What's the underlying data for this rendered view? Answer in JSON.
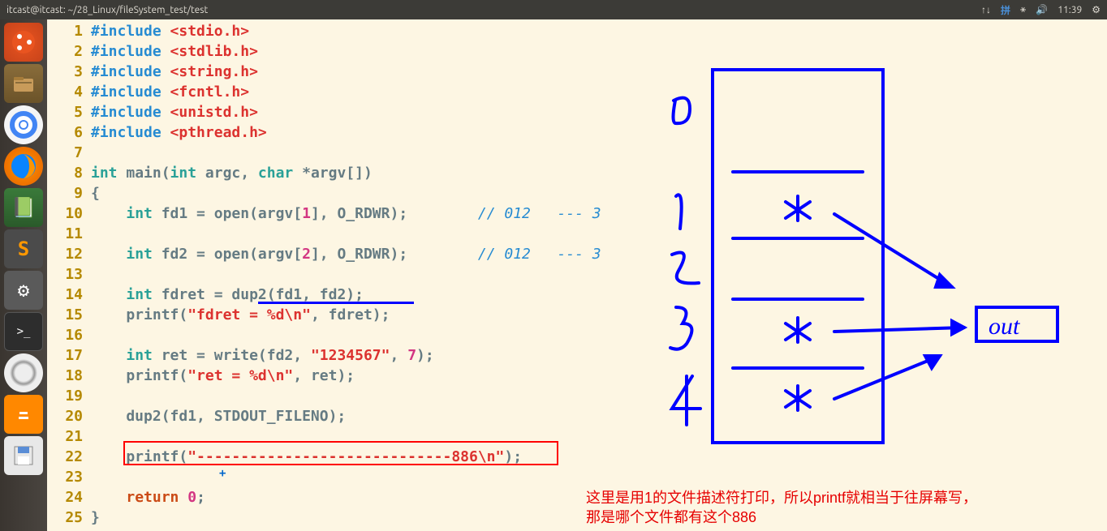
{
  "topbar": {
    "title": "itcast@itcast: ~/28_Linux/fileSystem_test/test",
    "ime": "拼",
    "time": "11:39"
  },
  "gutter_lines": [
    "1",
    "2",
    "3",
    "4",
    "5",
    "6",
    "7",
    "8",
    "9",
    "10",
    "11",
    "12",
    "13",
    "14",
    "15",
    "16",
    "17",
    "18",
    "19",
    "20",
    "21",
    "22",
    "23",
    "24",
    "25"
  ],
  "code": {
    "l1": {
      "inc": "#include ",
      "hdr": "<stdio.h>"
    },
    "l2": {
      "inc": "#include ",
      "hdr": "<stdlib.h>"
    },
    "l3": {
      "inc": "#include ",
      "hdr": "<string.h>"
    },
    "l4": {
      "inc": "#include ",
      "hdr": "<fcntl.h>"
    },
    "l5": {
      "inc": "#include ",
      "hdr": "<unistd.h>"
    },
    "l6": {
      "inc": "#include ",
      "hdr": "<pthread.h>"
    },
    "l8": {
      "a": "int",
      "b": " main(",
      "c": "int",
      "d": " argc, ",
      "e": "char",
      "f": " *argv[])"
    },
    "l9": "{",
    "l10": {
      "a": "    ",
      "b": "int",
      "c": " fd1 = open(argv[",
      "d": "1",
      "e": "], O_RDWR);        ",
      "f": "// 012   --- 3"
    },
    "l12": {
      "a": "    ",
      "b": "int",
      "c": " fd2 = open(argv[",
      "d": "2",
      "e": "], O_RDWR);        ",
      "f": "// 012   --- 3"
    },
    "l14": {
      "a": "    ",
      "b": "int",
      "c": " fdret = dup2(fd1, fd2);"
    },
    "l15": {
      "a": "    printf(",
      "b": "\"fdret = %d\\n\"",
      "c": ", fdret);"
    },
    "l17": {
      "a": "    ",
      "b": "int",
      "c": " ret = write(fd2, ",
      "d": "\"1234567\"",
      "e": ", ",
      "f": "7",
      "g": ");"
    },
    "l18": {
      "a": "    printf(",
      "b": "\"ret = %d\\n\"",
      "c": ", ret);"
    },
    "l20": {
      "a": "    dup2(fd1, STDOUT_FILENO);"
    },
    "l22": {
      "a": "    printf(",
      "b": "\"-----------------------------886\\n\"",
      "c": ");"
    },
    "l24": {
      "a": "    ",
      "b": "return",
      "c": " ",
      "d": "0",
      "e": ";"
    },
    "l25": "}"
  },
  "annotation": {
    "line1": "这里是用1的文件描述符打印，所以printf就相当于往屏幕写，",
    "line2": "那是哪个文件都有这个886"
  },
  "drawing": {
    "fd_labels": [
      "0",
      "1",
      "2",
      "3",
      "4"
    ],
    "out_label": "out"
  }
}
